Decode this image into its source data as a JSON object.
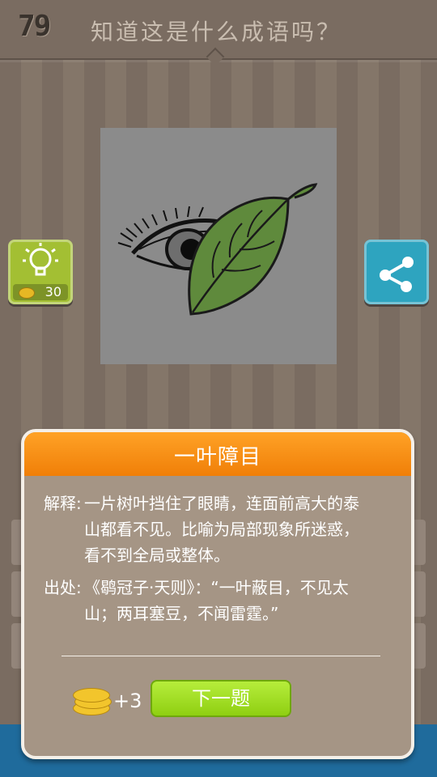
{
  "header": {
    "level": "79",
    "question": "知道这是什么成语吗？"
  },
  "hint": {
    "cost": "30"
  },
  "dialog": {
    "answer": "一叶障目",
    "explanation_label": "解释:",
    "explanation_lines": [
      "一片树叶挡住了眼睛，连面前高大的泰",
      "山都看不见。比喻为局部现象所迷惑，",
      "看不到全局或整体。"
    ],
    "source_label": "出处:",
    "source_lines": [
      "《鹖冠子·天则》：“一叶蔽目，不见太",
      "山；两耳塞豆，不闻雷霆。”"
    ],
    "reward": "+3",
    "next_button": "下一题"
  },
  "colors": {
    "header_orange": "#f5900f",
    "hint_green": "#a3bf33",
    "share_blue": "#2ea4bf",
    "next_green": "#9edc22"
  }
}
